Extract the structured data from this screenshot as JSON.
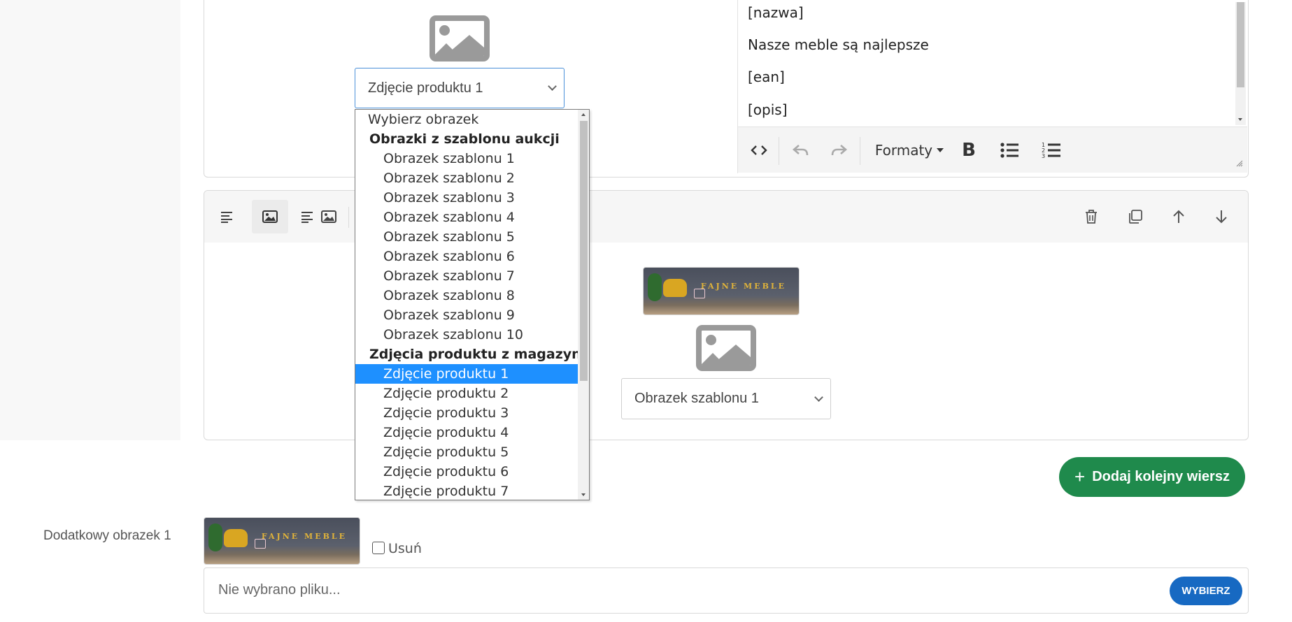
{
  "selects": {
    "top_image_select": "Zdjęcie produktu 1",
    "bottom_image_select": "Obrazek szablonu 1"
  },
  "editor": {
    "lines": [
      "[nazwa]",
      "Nasze meble są najlepsze",
      "[ean]",
      "[opis]"
    ],
    "formats_label": "Formaty",
    "bold_label": "B"
  },
  "dropdown": {
    "placeholder": "Wybierz obrazek",
    "groups": [
      {
        "label": "Obrazki z szablonu aukcji",
        "options": [
          "Obrazek szablonu 1",
          "Obrazek szablonu 2",
          "Obrazek szablonu 3",
          "Obrazek szablonu 4",
          "Obrazek szablonu 5",
          "Obrazek szablonu 6",
          "Obrazek szablonu 7",
          "Obrazek szablonu 8",
          "Obrazek szablonu 9",
          "Obrazek szablonu 10"
        ]
      },
      {
        "label": "Zdjęcia produktu z magazynu",
        "options": [
          "Zdjęcie produktu 1",
          "Zdjęcie produktu 2",
          "Zdjęcie produktu 3",
          "Zdjęcie produktu 4",
          "Zdjęcie produktu 5",
          "Zdjęcie produktu 6",
          "Zdjęcie produktu 7"
        ]
      }
    ],
    "selected": "Zdjęcie produktu 1"
  },
  "banner_text": "FAJNE MEBLE",
  "actions": {
    "add_row": "Dodaj kolejny wiersz",
    "add_row_icon": "+"
  },
  "extra_image": {
    "label": "Dodatkowy obrazek 1",
    "remove_label": "Usuń",
    "file_placeholder": "Nie wybrano pliku...",
    "choose_button": "WYBIERZ"
  },
  "icons": {
    "row_toolbar": [
      "align-left-icon",
      "image-icon",
      "text-image-icon",
      "trash-icon",
      "copy-icon",
      "arrow-up-icon",
      "arrow-down-icon"
    ],
    "editor_toolbar": [
      "code-icon",
      "undo-icon",
      "redo-icon",
      "bullet-list-icon",
      "numbered-list-icon"
    ]
  },
  "colors": {
    "selected_option": "#1e90ff",
    "add_button": "#1f8a4c",
    "choose_button": "#1769c2",
    "placeholder_icon": "#9a9a9a"
  }
}
